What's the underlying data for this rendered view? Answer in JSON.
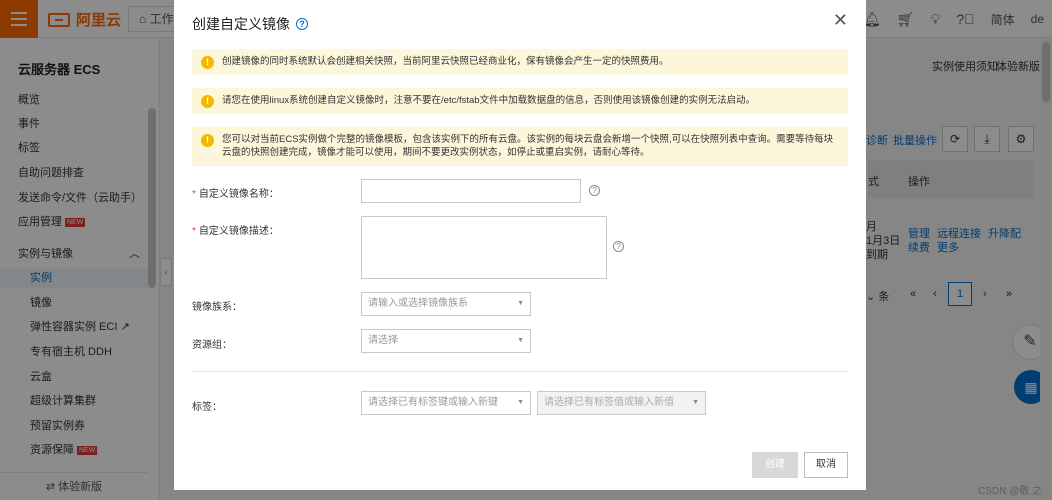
{
  "topbar": {
    "logo_text": "阿里云",
    "workspace_tab": "工作",
    "lang": "简体",
    "user_initials": "de"
  },
  "sidebar": {
    "title": "云服务器 ECS",
    "items": [
      {
        "label": "概览"
      },
      {
        "label": "事件"
      },
      {
        "label": "标签"
      },
      {
        "label": "自助问题排查"
      },
      {
        "label": "发送命令/文件（云助手）"
      },
      {
        "label": "应用管理",
        "badge": "NEW"
      }
    ],
    "section": "实例与镜像",
    "sub_items": [
      {
        "label": "实例",
        "active": true
      },
      {
        "label": "镜像"
      },
      {
        "label": "弹性容器实例 ECI"
      },
      {
        "label": "专有宿主机 DDH"
      },
      {
        "label": "云盒"
      },
      {
        "label": "超级计算集群"
      },
      {
        "label": "预留实例券"
      },
      {
        "label": "资源保障",
        "badge": "NEW"
      }
    ],
    "footer": "体验新版"
  },
  "background": {
    "links": [
      "实例使用须知",
      "体验新版"
    ],
    "toolbar_text": [
      "诊断",
      "批量操作"
    ],
    "table_headers": [
      "式",
      "操作"
    ],
    "row_col1": [
      "月",
      "1月3日",
      "到期"
    ],
    "row_actions": [
      "管理",
      "远程连接",
      "升降配",
      "续费",
      "更多"
    ],
    "pager": {
      "page_size_suffix": "条",
      "current_page": "1"
    },
    "watermark": "CSDN @敬 之"
  },
  "modal": {
    "title": "创建自定义镜像",
    "notices": [
      "创建镜像的同时系统默认会创建相关快照，当前阿里云快照已经商业化，保有镜像会产生一定的快照费用。",
      "请您在使用linux系统创建自定义镜像时，注意不要在/etc/fstab文件中加载数据盘的信息，否则使用该镜像创建的实例无法启动。",
      "您可以对当前ECS实例做个完整的镜像模板，包含该实例下的所有云盘。该实例的每块云盘会新增一个快照,可以在快照列表中查询。需要等待每块云盘的快照创建完成，镜像才能可以使用，期间不要更改实例状态，如停止或重启实例，请耐心等待。"
    ],
    "form": {
      "name_label": "自定义镜像名称：",
      "name_value": "",
      "desc_label": "自定义镜像描述：",
      "desc_value": "",
      "family_label": "镜像族系：",
      "family_placeholder": "请输入或选择镜像族系",
      "rg_label": "资源组：",
      "rg_placeholder": "请选择",
      "tag_label": "标签：",
      "tag_key_placeholder": "请选择已有标签键或输入新键",
      "tag_value_placeholder": "请选择已有标签值或输入新值"
    },
    "buttons": {
      "create": "创建",
      "cancel": "取消"
    }
  },
  "colors": {
    "brand": "#ff6a00",
    "link": "#0070cc",
    "notice_bg": "#fcf6db",
    "warning_icon": "#f5b800"
  },
  "icons": [
    "hamburger-icon",
    "home-icon",
    "bell-icon",
    "cart-icon",
    "lightbulb-icon",
    "help-icon",
    "close-icon",
    "info-icon",
    "refresh-icon",
    "download-icon",
    "settings-icon",
    "edit-icon",
    "grid-icon"
  ]
}
